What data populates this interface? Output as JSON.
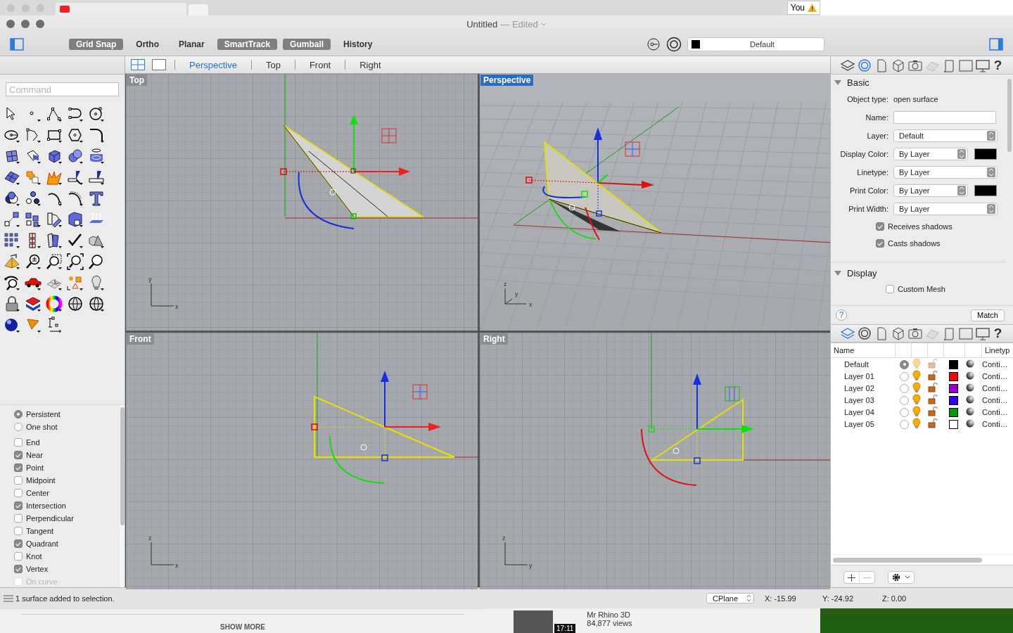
{
  "background_browser": {
    "top_badge": "You",
    "show_more": "SHOW MORE",
    "video": {
      "channel": "Mr Rhino 3D",
      "views": "84,877 views",
      "duration": "17:11"
    }
  },
  "window": {
    "title": "Untitled",
    "title_suffix": "— Edited"
  },
  "toolbar": {
    "toggles": [
      {
        "label": "Grid Snap",
        "on": true
      },
      {
        "label": "Ortho",
        "on": false
      },
      {
        "label": "Planar",
        "on": false
      },
      {
        "label": "SmartTrack",
        "on": true
      },
      {
        "label": "Gumball",
        "on": true
      },
      {
        "label": "History",
        "on": false
      }
    ],
    "layer": {
      "value": "Default",
      "color": "#000000"
    }
  },
  "command": {
    "placeholder": "Command"
  },
  "osnap": {
    "modes": [
      {
        "label": "Persistent",
        "selected": true
      },
      {
        "label": "One shot",
        "selected": false
      }
    ],
    "snaps": [
      {
        "label": "End",
        "checked": false,
        "disabled": false
      },
      {
        "label": "Near",
        "checked": true,
        "disabled": false
      },
      {
        "label": "Point",
        "checked": true,
        "disabled": false
      },
      {
        "label": "Midpoint",
        "checked": false,
        "disabled": false
      },
      {
        "label": "Center",
        "checked": false,
        "disabled": false
      },
      {
        "label": "Intersection",
        "checked": true,
        "disabled": false
      },
      {
        "label": "Perpendicular",
        "checked": false,
        "disabled": false
      },
      {
        "label": "Tangent",
        "checked": false,
        "disabled": false
      },
      {
        "label": "Quadrant",
        "checked": true,
        "disabled": false
      },
      {
        "label": "Knot",
        "checked": false,
        "disabled": false
      },
      {
        "label": "Vertex",
        "checked": true,
        "disabled": false
      },
      {
        "label": "On curve",
        "checked": false,
        "disabled": true
      }
    ]
  },
  "viewport_tabs": [
    {
      "label": "Perspective",
      "selected": true
    },
    {
      "label": "Top",
      "selected": false
    },
    {
      "label": "Front",
      "selected": false
    },
    {
      "label": "Right",
      "selected": false
    }
  ],
  "viewports": [
    {
      "kind": "top",
      "title": "Top",
      "active": false,
      "axes": [
        "y",
        "x"
      ]
    },
    {
      "kind": "perspective",
      "title": "Perspective",
      "active": true,
      "axes": [
        "z",
        "y",
        "x"
      ]
    },
    {
      "kind": "front",
      "title": "Front",
      "active": false,
      "axes": [
        "z",
        "x"
      ]
    },
    {
      "kind": "right",
      "title": "Right",
      "active": false,
      "axes": [
        "z",
        "y"
      ]
    }
  ],
  "properties": {
    "tabs": [
      {
        "kind": "layers",
        "selected": false
      },
      {
        "kind": "object",
        "selected": true
      },
      {
        "kind": "page",
        "selected": false
      },
      {
        "kind": "cube",
        "selected": false
      },
      {
        "kind": "camera",
        "selected": false
      },
      {
        "kind": "grid",
        "selected": false
      },
      {
        "kind": "scroll",
        "selected": false
      },
      {
        "kind": "frame",
        "selected": false
      },
      {
        "kind": "monitor",
        "selected": false
      },
      {
        "kind": "help",
        "selected": false,
        "label": "?"
      }
    ],
    "sections": [
      {
        "title": "Basic",
        "expanded": true,
        "fields": [
          {
            "kind": "info",
            "label": "Object type:",
            "value": "open surface"
          },
          {
            "kind": "text",
            "label": "Name:"
          },
          {
            "kind": "select",
            "label": "Layer:",
            "value": "Default"
          },
          {
            "kind": "select_color",
            "label": "Display Color:",
            "value": "By Layer",
            "color": "#000000"
          },
          {
            "kind": "select",
            "label": "Linetype:",
            "value": "By Layer"
          },
          {
            "kind": "select_color",
            "label": "Print Color:",
            "value": "By Layer",
            "color": "#000000"
          },
          {
            "kind": "select",
            "label": "Print Width:",
            "value": "By Layer"
          },
          {
            "kind": "checkbox",
            "label": "Receives shadows",
            "checked": true
          },
          {
            "kind": "checkbox",
            "label": "Casts shadows",
            "checked": true
          }
        ]
      },
      {
        "title": "Display",
        "expanded": true,
        "fields": [
          {
            "kind": "checkbox",
            "label": "Custom Mesh",
            "checked": false
          }
        ]
      }
    ],
    "help_label": "?",
    "match_button": "Match"
  },
  "layers": {
    "tabs": [
      {
        "kind": "layers",
        "selected": true
      },
      {
        "kind": "object",
        "selected": false
      },
      {
        "kind": "page",
        "selected": false
      },
      {
        "kind": "cube",
        "selected": false
      },
      {
        "kind": "camera",
        "selected": false
      },
      {
        "kind": "grid",
        "selected": false
      },
      {
        "kind": "scroll",
        "selected": false
      },
      {
        "kind": "frame",
        "selected": false
      },
      {
        "kind": "monitor",
        "selected": false
      },
      {
        "kind": "help",
        "selected": false,
        "label": "?"
      }
    ],
    "columns": [
      "Name",
      "Linetyp"
    ],
    "rows": [
      {
        "name": "Default",
        "current": true,
        "color": "#000000",
        "linetype": "Conti…"
      },
      {
        "name": "Layer 01",
        "current": false,
        "color": "#ff0000",
        "linetype": "Conti…"
      },
      {
        "name": "Layer 02",
        "current": false,
        "color": "#9900cc",
        "linetype": "Conti…"
      },
      {
        "name": "Layer 03",
        "current": false,
        "color": "#3300ff",
        "linetype": "Conti…"
      },
      {
        "name": "Layer 04",
        "current": false,
        "color": "#009900",
        "linetype": "Conti…"
      },
      {
        "name": "Layer 05",
        "current": false,
        "color": "#ffffff",
        "linetype": "Conti…"
      }
    ]
  },
  "status_bar": {
    "message": "1 surface added to selection.",
    "cplane": "CPlane",
    "x": "X: -15.99",
    "y": "Y: -24.92",
    "z": "Z: 0.00"
  }
}
